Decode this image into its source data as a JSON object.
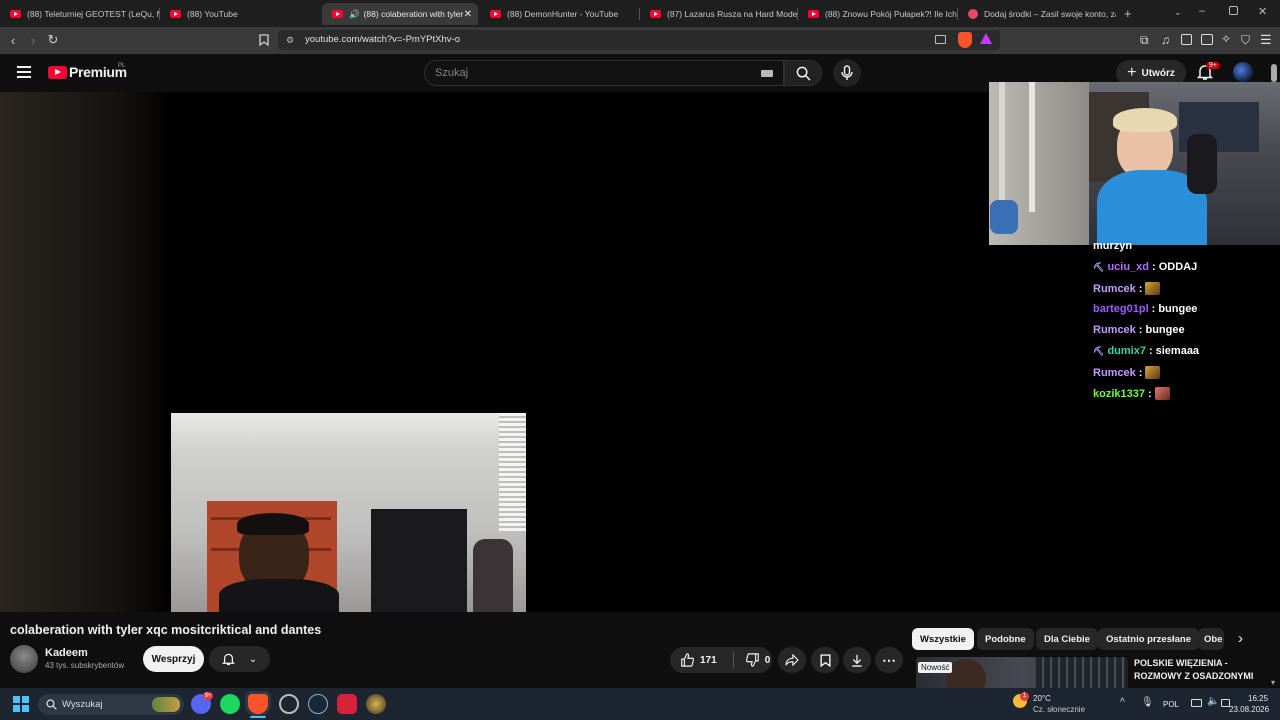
{
  "browser": {
    "tabs": [
      {
        "label": "(88) Teleturniej GEOTEST (LeQu, Ma",
        "active": false
      },
      {
        "label": "(88) YouTube",
        "active": false
      },
      {
        "label": "(88) colaberation with tyler",
        "active": true
      },
      {
        "label": "(88) DemonHunter - YouTube",
        "active": false
      },
      {
        "label": "(87) Lazarus Rusza na Hard Model 7",
        "active": false
      },
      {
        "label": "(88) Znowu Pokój Pułapek?! Ile Ich",
        "active": false
      },
      {
        "label": "Dodaj środki – Zasil swoje konto, za",
        "active": false
      }
    ],
    "url": "youtube.com/watch?v=-PmYPtXhv-o"
  },
  "youtube": {
    "logo_text": "Premium",
    "region": "PL",
    "search_placeholder": "Szukaj",
    "create_label": "Utwórz",
    "notif_badge": "9+"
  },
  "chat": [
    {
      "user": "murzyn",
      "message": "",
      "user_color": "#ffffff",
      "badge": false,
      "emote": ""
    },
    {
      "user": "uciu_xd",
      "message": "ODDAJ",
      "user_color": "#b36bff",
      "badge": true,
      "emote": ""
    },
    {
      "user": "Rumcek",
      "message": "",
      "user_color": "#c29bff",
      "badge": false,
      "emote": "#8a6a2a"
    },
    {
      "user": "barteg01pl",
      "message": "bungee",
      "user_color": "#9b5cff",
      "badge": false,
      "emote": ""
    },
    {
      "user": "Rumcek",
      "message": "bungee",
      "user_color": "#c29bff",
      "badge": false,
      "emote": ""
    },
    {
      "user": "dumix7",
      "message": "siemaaa",
      "user_color": "#33d6a6",
      "badge": true,
      "emote": ""
    },
    {
      "user": "Rumcek",
      "message": "",
      "user_color": "#c29bff",
      "badge": false,
      "emote": "#8a6a2a"
    },
    {
      "user": "kozik1337",
      "message": "",
      "user_color": "#6cff3a",
      "badge": false,
      "emote": "#b0453a"
    }
  ],
  "video": {
    "title": "colaberation with tyler xqc mositcriktical and dantes",
    "channel": "Kadeem",
    "subscribers": "43 tys. subskrybentów",
    "support_label": "Wesprzyj",
    "likes": "171",
    "dislikes": "0"
  },
  "filters": {
    "chips": [
      "Wszystkie",
      "Podobne",
      "Dla Ciebie",
      "Ostatnio przesłane",
      "Obe"
    ],
    "selected": 0
  },
  "recommended": {
    "badge": "Nowość",
    "title": "POLSKIE WIĘZIENIA - ROZMOWY Z OSADZONYMI"
  },
  "taskbar": {
    "search_label": "Wyszukaj",
    "weather_temp": "20°C",
    "weather_desc": "Cz. słonecznie",
    "language": "POL",
    "time": "16:25",
    "date": "23.08.2026",
    "weather_badge": "1"
  }
}
